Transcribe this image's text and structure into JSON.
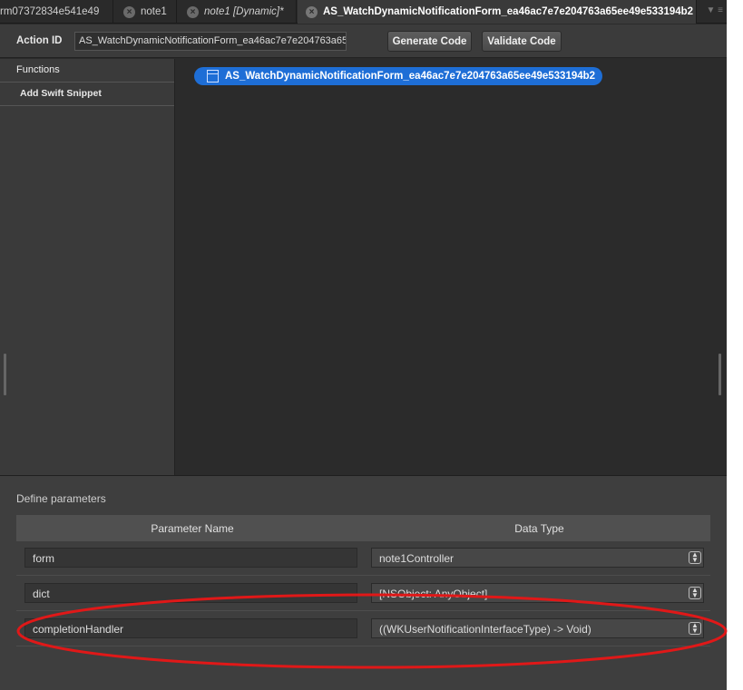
{
  "tabs": [
    {
      "label": "rm07372834e541e49",
      "closable": false
    },
    {
      "label": "note1",
      "closable": true
    },
    {
      "label": "note1 [Dynamic]*",
      "closable": true
    },
    {
      "label": "AS_WatchDynamicNotificationForm_ea46ac7e7e204763a65ee49e533194b2",
      "closable": true,
      "active": true
    }
  ],
  "toolbar": {
    "action_id_label": "Action ID",
    "action_id_value": "AS_WatchDynamicNotificationForm_ea46ac7e7e204763a65",
    "generate_label": "Generate Code",
    "validate_label": "Validate Code"
  },
  "sidebar": {
    "items": [
      {
        "label": "Functions"
      },
      {
        "label": "Add Swift Snippet"
      }
    ]
  },
  "canvas": {
    "node_label": "AS_WatchDynamicNotificationForm_ea46ac7e7e204763a65ee49e533194b2"
  },
  "params": {
    "title": "Define parameters",
    "col_name": "Parameter Name",
    "col_type": "Data Type",
    "rows": [
      {
        "name": "form",
        "type": "note1Controller"
      },
      {
        "name": "dict",
        "type": "[NSObject: AnyObject]"
      },
      {
        "name": "completionHandler",
        "type": "((WKUserNotificationInterfaceType) -> Void)"
      }
    ]
  },
  "annotation_color": "#e01818",
  "accent_color": "#1e6ed6"
}
